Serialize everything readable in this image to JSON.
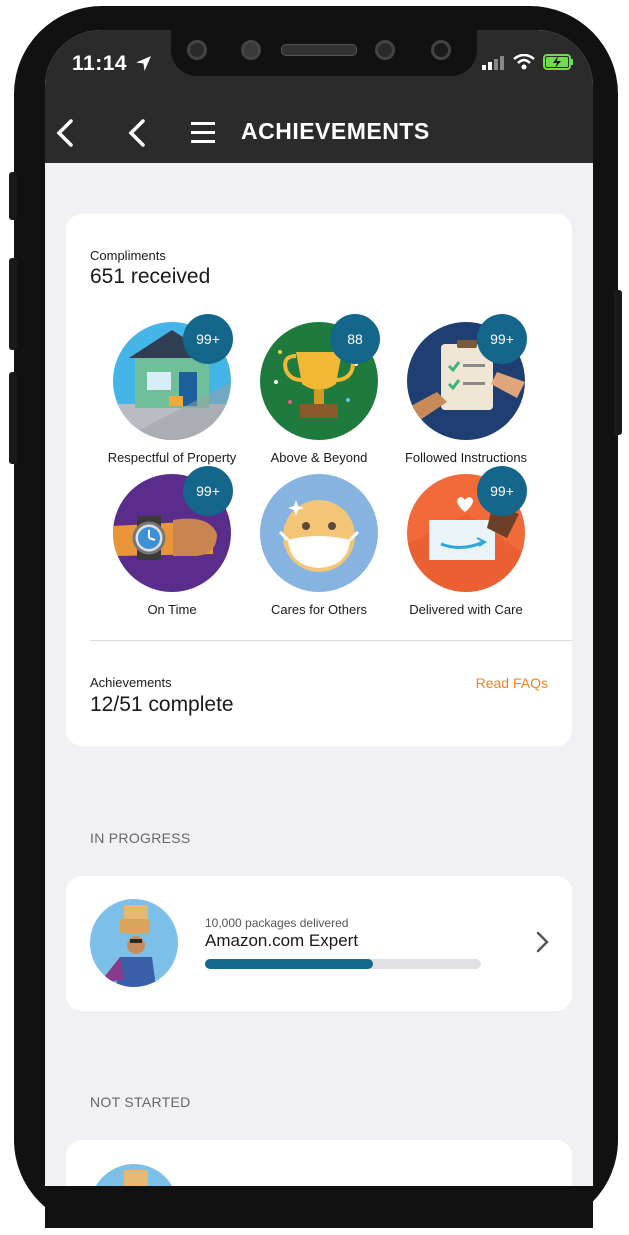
{
  "status_bar": {
    "time": "11:14",
    "location_icon": "location-arrow-icon",
    "icons": [
      "signal-icon",
      "wifi-icon",
      "battery-charging-icon"
    ]
  },
  "nav": {
    "title": "ACHIEVEMENTS",
    "back_icon_1": "chevron-left-icon",
    "back_icon_2": "chevron-left-icon",
    "menu_icon": "hamburger-menu-icon"
  },
  "compliments": {
    "label": "Compliments",
    "value": "651 received",
    "badges": [
      {
        "label": "Respectful of Property",
        "count": "99+"
      },
      {
        "label": "Above & Beyond",
        "count": "88"
      },
      {
        "label": "Followed Instructions",
        "count": "99+"
      },
      {
        "label": "On Time",
        "count": "99+"
      },
      {
        "label": "Cares for Others",
        "count": ""
      },
      {
        "label": "Delivered with Care",
        "count": "99+"
      }
    ]
  },
  "achievements": {
    "label": "Achievements",
    "value": "12/51 complete",
    "faq_link": "Read FAQs"
  },
  "in_progress": {
    "header": "IN PROGRESS",
    "items": [
      {
        "subtitle": "10,000 packages delivered",
        "title": "Amazon.com Expert",
        "progress": 0.61
      }
    ]
  },
  "not_started": {
    "header": "NOT STARTED"
  },
  "colors": {
    "accent": "#15668b",
    "link": "#e8862c",
    "nav_bg": "#2b2b2b",
    "screen_bg": "#f1f1f5"
  }
}
